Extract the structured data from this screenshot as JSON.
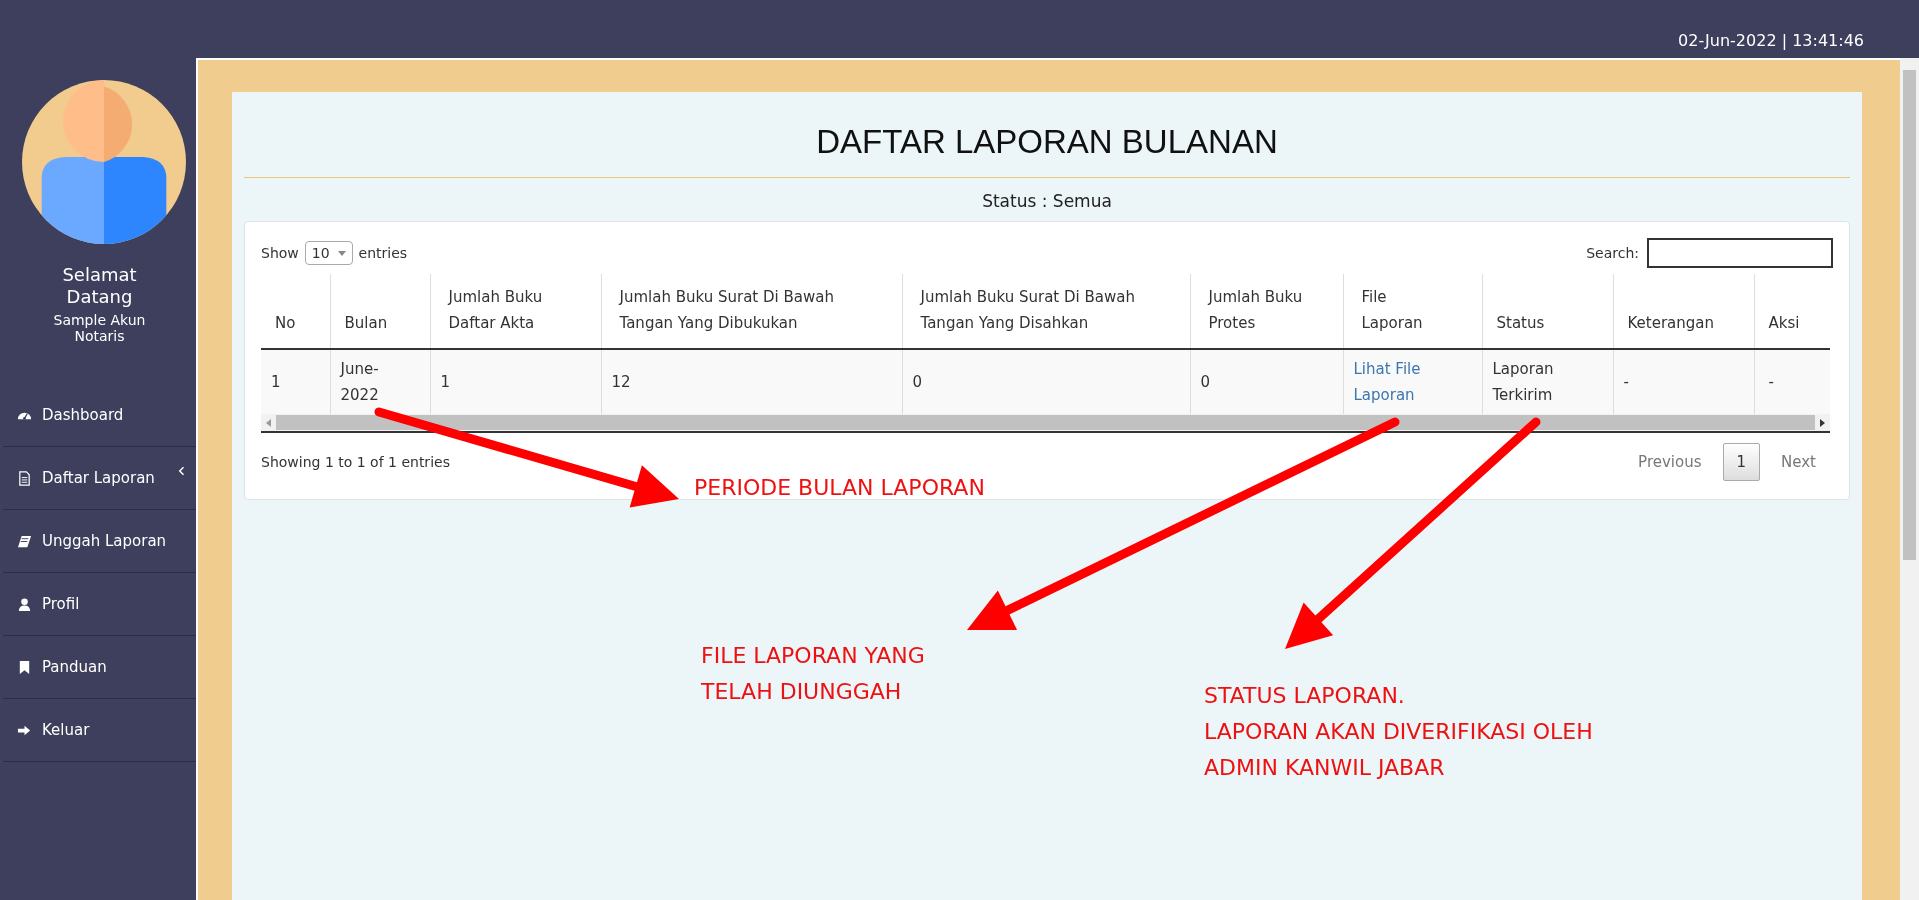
{
  "top_bar": {
    "datetime": "02-Jun-2022 | 13:41:46"
  },
  "sidebar": {
    "greeting": "Selamat Datang",
    "user": "Sample Akun Notaris",
    "items": [
      {
        "label": "Dashboard",
        "has_submenu": false
      },
      {
        "label": "Daftar Laporan",
        "has_submenu": true
      },
      {
        "label": "Unggah Laporan",
        "has_submenu": false
      },
      {
        "label": "Profil",
        "has_submenu": false
      },
      {
        "label": "Panduan",
        "has_submenu": false
      },
      {
        "label": "Keluar",
        "has_submenu": false
      }
    ]
  },
  "page": {
    "title": "DAFTAR LAPORAN BULANAN",
    "status_filter": "Status : Semua"
  },
  "table": {
    "length_label_before": "Show",
    "length_value": "10",
    "length_label_after": "entries",
    "search_label": "Search:",
    "columns": [
      "No",
      "Bulan",
      "Jumlah Buku Daftar Akta",
      "Jumlah Buku Surat Di Bawah Tangan Yang Dibukukan",
      "Jumlah Buku Surat Di Bawah Tangan Yang Disahkan",
      "Jumlah Buku Protes",
      "File Laporan",
      "Status",
      "Keterangan",
      "Aksi"
    ],
    "rows": [
      {
        "cells": [
          "1",
          "June-2022",
          "1",
          "12",
          "0",
          "0",
          "Lihat File Laporan",
          "Laporan Terkirim",
          "-",
          "-"
        ]
      }
    ],
    "info": "Showing 1 to 1 of 1 entries",
    "pagination": [
      {
        "label": "Previous",
        "kind": "prev",
        "disabled": true,
        "selected": false
      },
      {
        "label": "1",
        "kind": "page",
        "disabled": false,
        "selected": true
      },
      {
        "label": "Next",
        "kind": "next",
        "disabled": true,
        "selected": false
      }
    ]
  },
  "annotations": [
    {
      "lines": [
        "PERIODE BULAN LAPORAN"
      ]
    },
    {
      "lines": [
        "FILE LAPORAN YANG",
        "TELAH DIUNGGAH"
      ]
    },
    {
      "lines": [
        "STATUS LAPORAN.",
        "LAPORAN AKAN DIVERIFIKASI OLEH",
        "ADMIN KANWIL JABAR"
      ]
    }
  ]
}
